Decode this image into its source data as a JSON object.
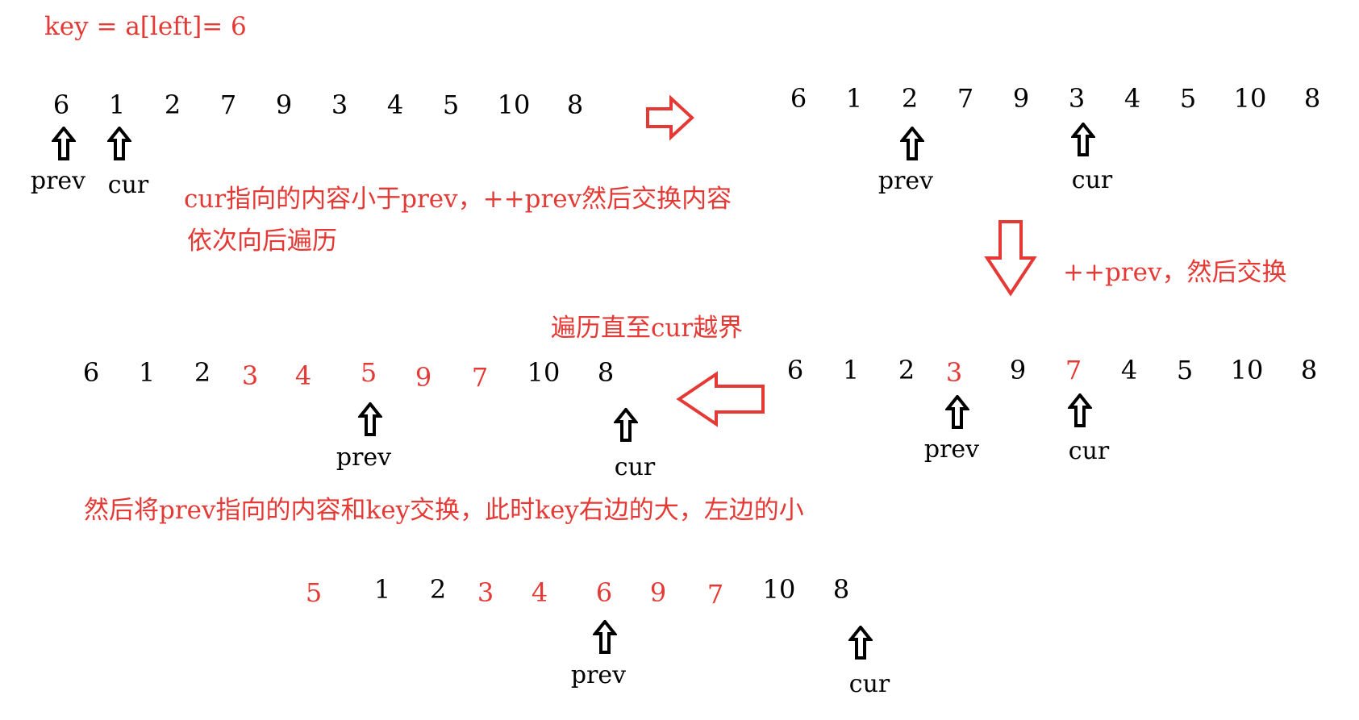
{
  "header": {
    "key_expr": "key = a[left]= 6"
  },
  "notes": {
    "step1_line1": "cur指向的内容小于prev，++prev然后交换内容",
    "step1_line2": "依次向后遍历",
    "step2": "++prev，然后交换",
    "step3": "遍历直至cur越界",
    "step4": "然后将prev指向的内容和key交换，此时key右边的大，左边的小"
  },
  "pointer_labels": {
    "prev": "prev",
    "cur": "cur"
  },
  "colors": {
    "annotation": "#e53935",
    "normal": "#000000"
  },
  "icons": [
    "up-arrow-icon",
    "right-arrow-icon",
    "down-arrow-icon",
    "left-arrow-icon"
  ],
  "arrays": {
    "stage1": [
      {
        "v": "6",
        "red": false
      },
      {
        "v": "1",
        "red": false
      },
      {
        "v": "2",
        "red": false
      },
      {
        "v": "7",
        "red": false
      },
      {
        "v": "9",
        "red": false
      },
      {
        "v": "3",
        "red": false
      },
      {
        "v": "4",
        "red": false
      },
      {
        "v": "5",
        "red": false
      },
      {
        "v": "10",
        "red": false
      },
      {
        "v": "8",
        "red": false
      }
    ],
    "stage2": [
      {
        "v": "6",
        "red": false
      },
      {
        "v": "1",
        "red": false
      },
      {
        "v": "2",
        "red": false
      },
      {
        "v": "7",
        "red": false
      },
      {
        "v": "9",
        "red": false
      },
      {
        "v": "3",
        "red": false
      },
      {
        "v": "4",
        "red": false
      },
      {
        "v": "5",
        "red": false
      },
      {
        "v": "10",
        "red": false
      },
      {
        "v": "8",
        "red": false
      }
    ],
    "stage3": [
      {
        "v": "6",
        "red": false
      },
      {
        "v": "1",
        "red": false
      },
      {
        "v": "2",
        "red": false
      },
      {
        "v": "3",
        "red": true
      },
      {
        "v": "9",
        "red": false
      },
      {
        "v": "7",
        "red": true
      },
      {
        "v": "4",
        "red": false
      },
      {
        "v": "5",
        "red": false
      },
      {
        "v": "10",
        "red": false
      },
      {
        "v": "8",
        "red": false
      }
    ],
    "stage4": [
      {
        "v": "6",
        "red": false
      },
      {
        "v": "1",
        "red": false
      },
      {
        "v": "2",
        "red": false
      },
      {
        "v": "3",
        "red": true
      },
      {
        "v": "4",
        "red": true
      },
      {
        "v": "5",
        "red": true
      },
      {
        "v": "9",
        "red": true
      },
      {
        "v": "7",
        "red": true
      },
      {
        "v": "10",
        "red": false
      },
      {
        "v": "8",
        "red": false
      }
    ],
    "stage5": [
      {
        "v": "5",
        "red": true
      },
      {
        "v": "1",
        "red": false
      },
      {
        "v": "2",
        "red": false
      },
      {
        "v": "3",
        "red": true
      },
      {
        "v": "4",
        "red": true
      },
      {
        "v": "6",
        "red": true
      },
      {
        "v": "9",
        "red": true
      },
      {
        "v": "7",
        "red": true
      },
      {
        "v": "10",
        "red": false
      },
      {
        "v": "8",
        "red": false
      }
    ]
  }
}
